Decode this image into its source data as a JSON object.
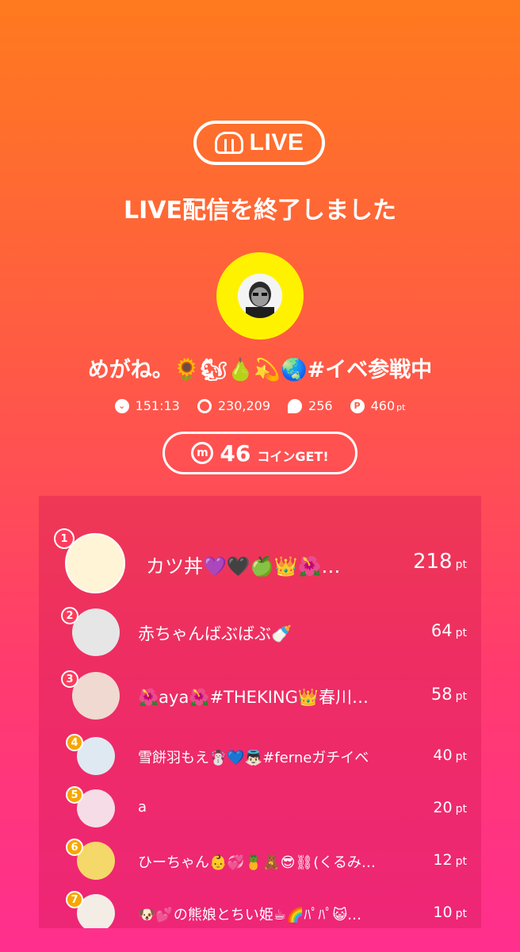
{
  "brand": {
    "logo_text": "LIVE"
  },
  "ended_title": "LIVE配信を終了しました",
  "host": {
    "name": "めがね。🌻🐿🍐💫🌏#イベ参戦中"
  },
  "stats": {
    "duration": "151:13",
    "viewers": "230,209",
    "comments": "256",
    "points": "460",
    "points_unit": "pt"
  },
  "coin": {
    "count": "46",
    "label": "コインGET!"
  },
  "ranking": [
    {
      "rank": "1",
      "name": "カツ丼💜🖤🍏👑🌺…",
      "score": "218",
      "unit": "pt"
    },
    {
      "rank": "2",
      "name": "赤ちゃんばぶばぶ🍼",
      "score": "64",
      "unit": "pt"
    },
    {
      "rank": "3",
      "name": "🌺aya🌺#THEKING👑春川…",
      "score": "58",
      "unit": "pt"
    },
    {
      "rank": "4",
      "name": "雪餅羽もえ☃️💙👼🏻#ferneガチイベ",
      "score": "40",
      "unit": "pt"
    },
    {
      "rank": "5",
      "name": "a",
      "score": "20",
      "unit": "pt"
    },
    {
      "rank": "6",
      "name": "ひーちゃん👶💞🍍🧸😎⛓(くるみ…",
      "score": "12",
      "unit": "pt"
    },
    {
      "rank": "7",
      "name": "🐶💕の熊娘とちい姫☕🌈ﾊﾟﾊﾟ😺…",
      "score": "10",
      "unit": "pt"
    }
  ],
  "colors": {
    "gold": "#f7a600",
    "pink": "#ff3b5c",
    "avatar_yellow": "#fff200"
  }
}
